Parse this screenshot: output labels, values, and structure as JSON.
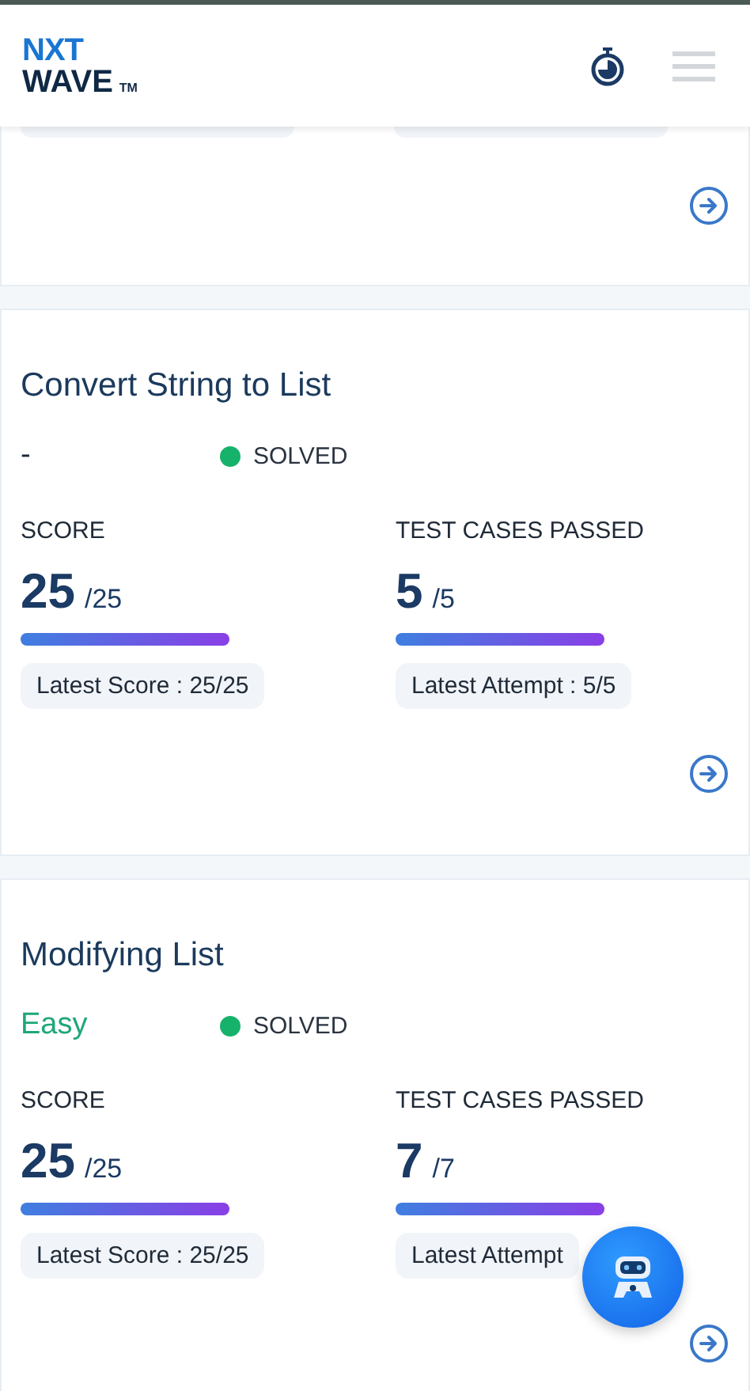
{
  "header": {
    "logo_top": "NXT",
    "logo_bottom": "WAVE",
    "trademark": "TM"
  },
  "cards": [
    {
      "title": "Convert String to List",
      "difficulty": {
        "label": "-",
        "color": "#1e2a3a"
      },
      "status": "SOLVED",
      "score": {
        "label": "SCORE",
        "value": "25",
        "total": "/25",
        "level": 1,
        "latest": "Latest Score : 25/25"
      },
      "tests": {
        "label": "TEST CASES PASSED",
        "value": "5",
        "total": "/5",
        "level": 1,
        "latest": "Latest Attempt : 5/5"
      }
    },
    {
      "title": "Modifying List",
      "difficulty": {
        "label": "Easy",
        "color": "#1fa67a"
      },
      "status": "SOLVED",
      "score": {
        "label": "SCORE",
        "value": "25",
        "total": "/25",
        "level": 1,
        "latest": "Latest Score : 25/25"
      },
      "tests": {
        "label": "TEST CASES PASSED",
        "value": "7",
        "total": "/7",
        "level": 1,
        "latest": "Latest Attempt"
      }
    }
  ],
  "chatbot": {
    "visible": true
  }
}
